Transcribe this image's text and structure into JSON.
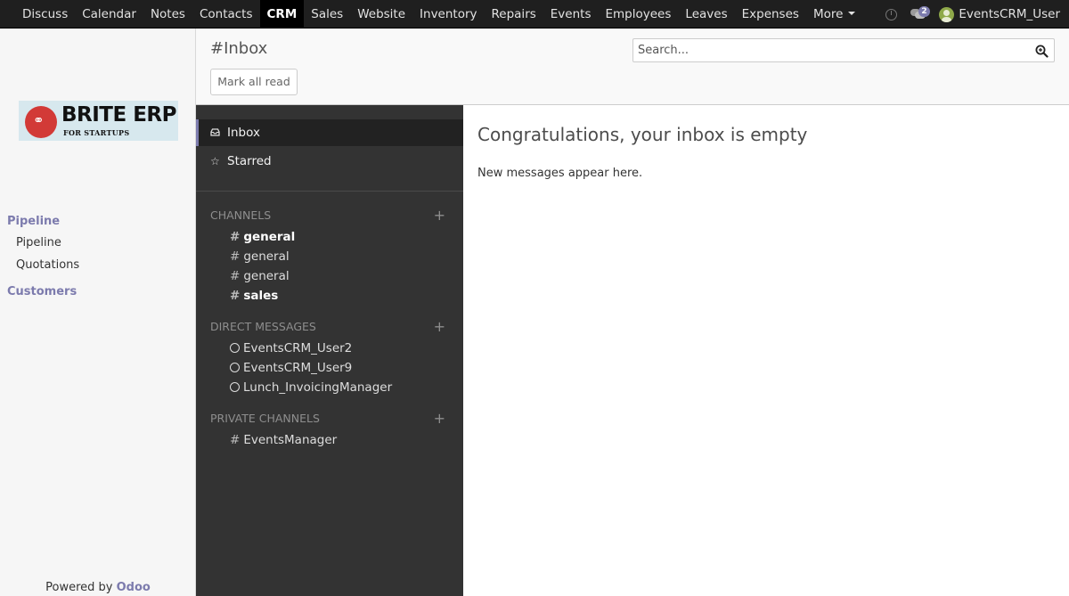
{
  "menu": {
    "items": [
      "Discuss",
      "Calendar",
      "Notes",
      "Contacts",
      "CRM",
      "Sales",
      "Website",
      "Inventory",
      "Repairs",
      "Events",
      "Employees",
      "Leaves",
      "Expenses",
      "More"
    ],
    "active": "CRM"
  },
  "topbar": {
    "chat_count": "2",
    "username": "EventsCRM_User"
  },
  "logo": {
    "title": "BRITE ERP",
    "subtitle": "FOR STARTUPS"
  },
  "sidebar": {
    "section1": "Pipeline",
    "items": [
      "Pipeline",
      "Quotations"
    ],
    "section2": "Customers",
    "powered_prefix": "Powered by ",
    "powered_brand": "Odoo"
  },
  "control_panel": {
    "breadcrumb": "#Inbox",
    "mark_all_read": "Mark all read",
    "search_placeholder": "Search..."
  },
  "discuss": {
    "inbox": "Inbox",
    "starred": "Starred",
    "channels_header": "Channels",
    "channels": [
      {
        "name": "general",
        "bold": true
      },
      {
        "name": "general",
        "bold": false
      },
      {
        "name": "general",
        "bold": false
      },
      {
        "name": "sales",
        "bold": true
      }
    ],
    "dm_header": "Direct Messages",
    "direct_messages": [
      "EventsCRM_User2",
      "EventsCRM_User9",
      "Lunch_InvoicingManager"
    ],
    "private_header": "Private Channels",
    "private_channels": [
      "EventsManager"
    ]
  },
  "content": {
    "title": "Congratulations, your inbox is empty",
    "text": "New messages appear here."
  },
  "colors": {
    "accent": "#7c7bad",
    "topbar": "#1f1f1f",
    "discuss_sidebar": "#333333"
  }
}
